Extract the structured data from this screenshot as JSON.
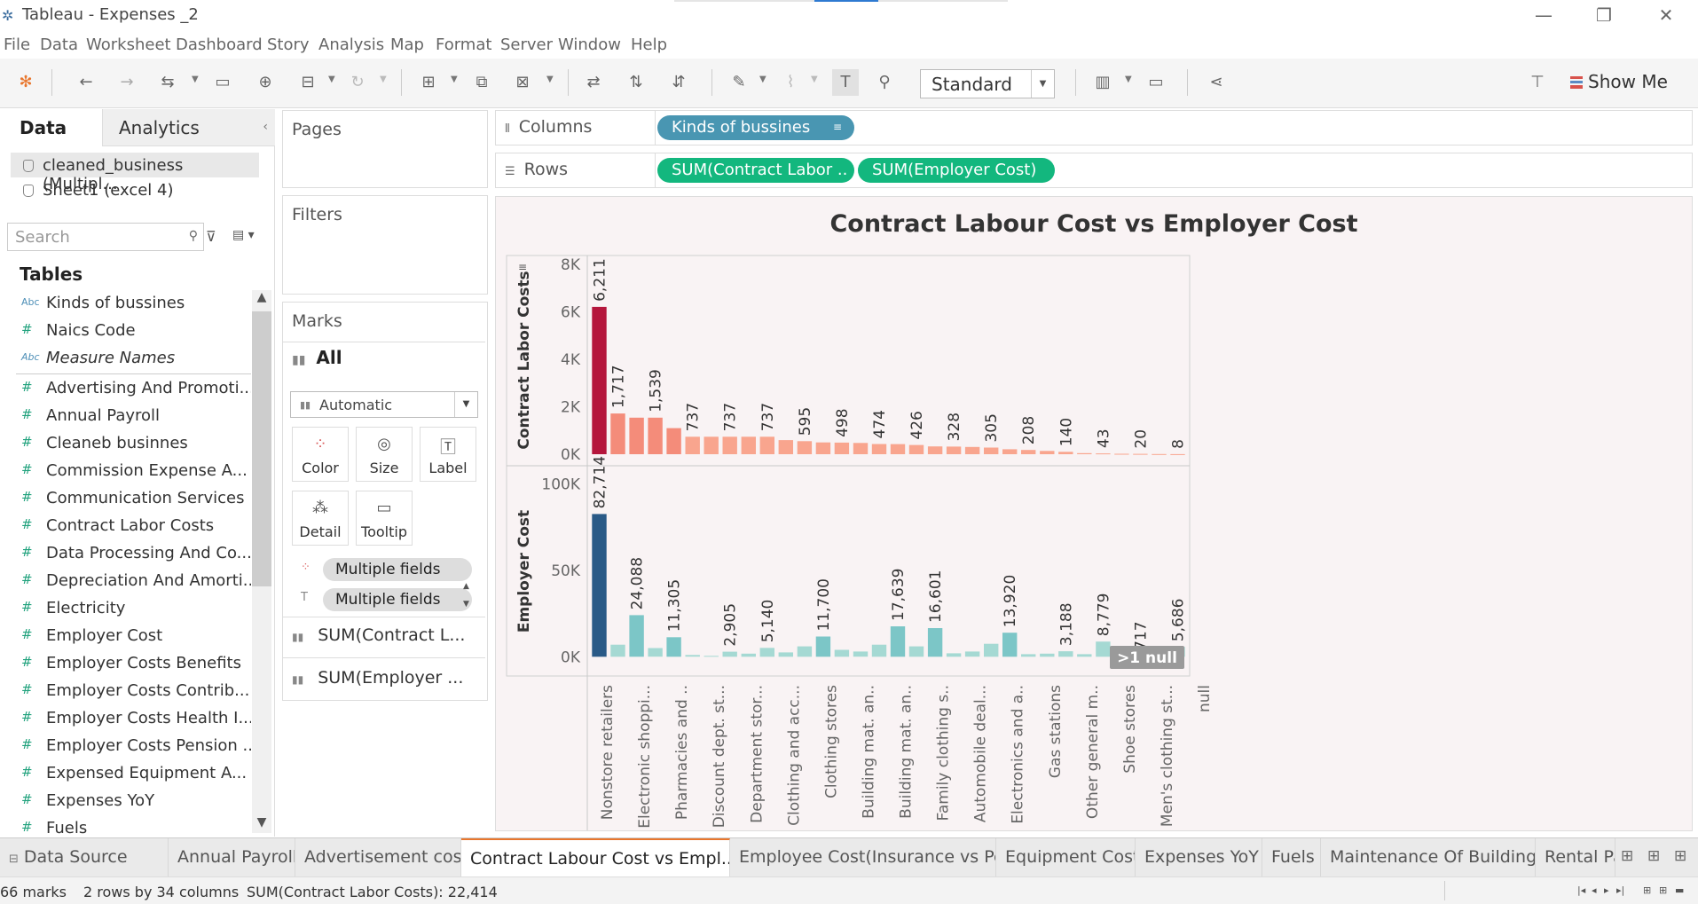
{
  "window": {
    "title": "Tableau - Expenses _2",
    "minimize": "—",
    "restore": "❐",
    "close": "✕"
  },
  "menu": [
    "File",
    "Data",
    "Worksheet",
    "Dashboard",
    "Story",
    "Analysis",
    "Map",
    "Format",
    "Server",
    "Window",
    "Help"
  ],
  "toolbar": {
    "fit": "Standard",
    "show_me": "Show Me"
  },
  "data_pane": {
    "tab_data": "Data",
    "tab_analytics": "Analytics",
    "sources": [
      "cleaned_business (Multipl...",
      "Sheet1 (excel 4)"
    ],
    "search_placeholder": "Search",
    "tables_heading": "Tables",
    "fields": [
      {
        "type": "Abc",
        "name": "Kinds of bussines"
      },
      {
        "type": "#",
        "name": "Naics Code"
      },
      {
        "type": "Abc",
        "name": "Measure Names"
      },
      {
        "type": "#",
        "name": "Advertising And Promoti..."
      },
      {
        "type": "#",
        "name": "Annual Payroll"
      },
      {
        "type": "#",
        "name": "Cleaneb businnes"
      },
      {
        "type": "#",
        "name": "Commission Expense A..."
      },
      {
        "type": "#",
        "name": "Communication Services"
      },
      {
        "type": "#",
        "name": "Contract Labor Costs"
      },
      {
        "type": "#",
        "name": "Data Processing And Co..."
      },
      {
        "type": "#",
        "name": "Depreciation And Amorti..."
      },
      {
        "type": "#",
        "name": "Electricity"
      },
      {
        "type": "#",
        "name": "Employer Cost"
      },
      {
        "type": "#",
        "name": "Employer Costs Benefits"
      },
      {
        "type": "#",
        "name": "Employer Costs Contrib..."
      },
      {
        "type": "#",
        "name": "Employer Costs Health I..."
      },
      {
        "type": "#",
        "name": "Employer Costs Pension ..."
      },
      {
        "type": "#",
        "name": "Expensed Equipment A..."
      },
      {
        "type": "#",
        "name": "Expenses YoY"
      },
      {
        "type": "#",
        "name": "Fuels"
      }
    ]
  },
  "shelves": {
    "pages": "Pages",
    "filters": "Filters",
    "marks": "Marks",
    "marks_all": "All",
    "mark_type": "Automatic",
    "buttons": {
      "color": "Color",
      "size": "Size",
      "label": "Label",
      "detail": "Detail",
      "tooltip": "Tooltip"
    },
    "mark_pills": [
      "Multiple fields",
      "Multiple fields"
    ],
    "mark_fields": [
      "SUM(Contract L...",
      "SUM(Employer ..."
    ],
    "columns_label": "Columns",
    "rows_label": "Rows",
    "columns_pill": "Kinds of bussines",
    "rows_pills": [
      "SUM(Contract Labor ..",
      "SUM(Employer Cost)"
    ]
  },
  "chart_data": {
    "type": "bar",
    "title": "Contract Labour Cost vs Employer Cost",
    "categories": [
      "Nonstore retailers",
      "Electronic shoppi...",
      "Pharmacies and ..",
      "Discount dept. st...",
      "Department stor...",
      "Clothing and acc...",
      "Clothing stores",
      "Building mat. an..",
      "Building mat. an..",
      "Family clothing s..",
      "Automobile deal...",
      "Electronics and a..",
      "Gas stations",
      "Other general m..",
      "Shoe stores",
      "Men's clothing st...",
      "null"
    ],
    "panes": [
      {
        "ylabel": "Contract Labor Costs",
        "yticks": [
          "8K",
          "6K",
          "4K",
          "2K",
          "0K"
        ],
        "ylim": [
          0,
          8000
        ],
        "values": [
          6211,
          1717,
          1539,
          1539,
          1100,
          737,
          737,
          737,
          737,
          737,
          595,
          550,
          498,
          490,
          474,
          430,
          426,
          390,
          328,
          320,
          305,
          280,
          208,
          180,
          140,
          100,
          43,
          35,
          20,
          15,
          8,
          5
        ],
        "labels": [
          {
            "i": 0,
            "text": "6,211"
          },
          {
            "i": 1,
            "text": "1,717"
          },
          {
            "i": 3,
            "text": "1,539"
          },
          {
            "i": 5,
            "text": "737"
          },
          {
            "i": 7,
            "text": "737"
          },
          {
            "i": 9,
            "text": "737"
          },
          {
            "i": 11,
            "text": "595"
          },
          {
            "i": 13,
            "text": "498"
          },
          {
            "i": 15,
            "text": "474"
          },
          {
            "i": 17,
            "text": "426"
          },
          {
            "i": 19,
            "text": "328"
          },
          {
            "i": 21,
            "text": "305"
          },
          {
            "i": 23,
            "text": "208"
          },
          {
            "i": 25,
            "text": "140"
          },
          {
            "i": 27,
            "text": "43"
          },
          {
            "i": 29,
            "text": "20"
          },
          {
            "i": 31,
            "text": "8"
          }
        ],
        "highlight_color": "#b5163c",
        "bar_color": "#f9a58e"
      },
      {
        "ylabel": "Employer Cost",
        "yticks": [
          "100K",
          "50K",
          "0K"
        ],
        "ylim": [
          -5000,
          105000
        ],
        "values": [
          82714,
          7000,
          24088,
          5000,
          11305,
          1000,
          500,
          2905,
          1800,
          5140,
          2500,
          6000,
          11700,
          4000,
          3000,
          7000,
          17639,
          6000,
          16601,
          2000,
          3000,
          7500,
          13920,
          1500,
          1800,
          3188,
          1500,
          8779,
          1000,
          717,
          500,
          5686
        ],
        "labels": [
          {
            "i": 0,
            "text": "82,714"
          },
          {
            "i": 2,
            "text": "24,088"
          },
          {
            "i": 4,
            "text": "11,305"
          },
          {
            "i": 7,
            "text": "2,905"
          },
          {
            "i": 9,
            "text": "5,140"
          },
          {
            "i": 12,
            "text": "11,700"
          },
          {
            "i": 16,
            "text": "17,639"
          },
          {
            "i": 18,
            "text": "16,601"
          },
          {
            "i": 22,
            "text": "13,920"
          },
          {
            "i": 25,
            "text": "3,188"
          },
          {
            "i": 27,
            "text": "8,779"
          },
          {
            "i": 29,
            "text": "717"
          },
          {
            "i": 31,
            "text": "5,686"
          }
        ],
        "highlight_color": "#2a5a87",
        "bar_color": "#a5d9d3",
        "mid_color": "#7cc6c7"
      }
    ],
    "null_badge": ">1 null"
  },
  "sheet_tabs": [
    "Data Source",
    "Annual Payroll",
    "Advertisement cost",
    "Contract Labour Cost vs Empl...",
    "Employee Cost(Insurance vs Pe...",
    "Equipment Cost",
    "Expenses YoY",
    "Fuels",
    "Maintenance Of Buildings",
    "Rental Pay"
  ],
  "active_tab": 3,
  "status": {
    "marks": "66 marks",
    "dims": "2 rows by 34 columns",
    "sum": "SUM(Contract Labor Costs): 22,414"
  }
}
